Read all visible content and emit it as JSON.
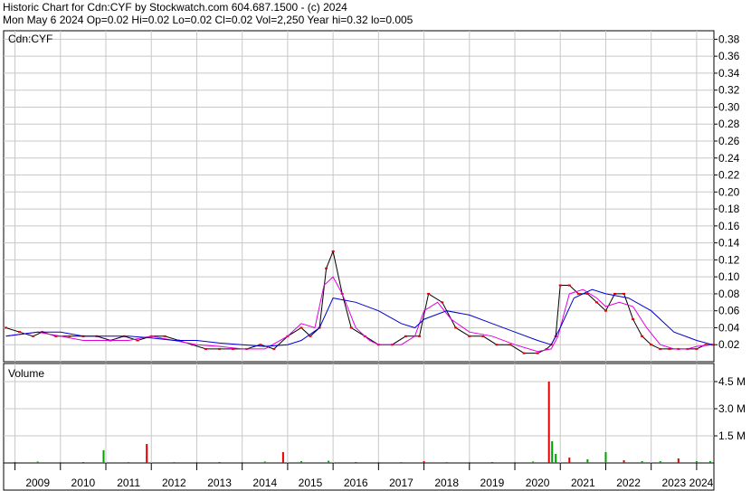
{
  "header": {
    "line1": "Historic Chart for Cdn:CYF by Stockwatch.com 604.687.1500 - (c) 2024",
    "line2": "Mon May  6 2024  Op=0.02  Hi=0.02  Lo=0.02  Cl=0.02  Vol=2,250  Year hi=0.32  lo=0.005"
  },
  "colors": {
    "price_bar": "#000000",
    "down_close": "#e00000",
    "ma_short": "#e000e0",
    "ma_long": "#0000d0",
    "volume_up": "#00a000",
    "volume_down": "#e00000",
    "grid": "#c8c8c8"
  },
  "chart_data": [
    {
      "type": "line",
      "title": "Cdn:CYF",
      "ylim": [
        0,
        0.39
      ],
      "yticks": [
        "0.02",
        "0.04",
        "0.06",
        "0.08",
        "0.10",
        "0.12",
        "0.14",
        "0.16",
        "0.18",
        "0.20",
        "0.22",
        "0.24",
        "0.26",
        "0.28",
        "0.30",
        "0.32",
        "0.34",
        "0.36",
        "0.38"
      ],
      "x_labels": [
        "2009",
        "2010",
        "2011",
        "2012",
        "2013",
        "2014",
        "2015",
        "2016",
        "2017",
        "2018",
        "2019",
        "2020",
        "2021",
        "2022",
        "2023",
        "2024"
      ],
      "series": [
        {
          "key": "price",
          "x": [
            2008.8,
            2009.1,
            2009.4,
            2009.6,
            2009.9,
            2010.2,
            2010.5,
            2010.8,
            2011.1,
            2011.4,
            2011.7,
            2012.0,
            2012.3,
            2012.6,
            2012.9,
            2013.2,
            2013.5,
            2013.8,
            2014.1,
            2014.4,
            2014.7,
            2015.0,
            2015.3,
            2015.5,
            2015.7,
            2015.85,
            2016.0,
            2016.2,
            2016.4,
            2016.7,
            2017.0,
            2017.3,
            2017.6,
            2017.9,
            2018.1,
            2018.4,
            2018.7,
            2019.0,
            2019.3,
            2019.6,
            2019.9,
            2020.2,
            2020.5,
            2020.7,
            2020.8,
            2020.9,
            2021.0,
            2021.2,
            2021.4,
            2021.6,
            2021.8,
            2022.0,
            2022.2,
            2022.4,
            2022.6,
            2022.8,
            2023.0,
            2023.2,
            2023.4,
            2023.6,
            2023.8,
            2024.0,
            2024.2,
            2024.35
          ],
          "values": [
            0.04,
            0.035,
            0.03,
            0.035,
            0.03,
            0.03,
            0.03,
            0.03,
            0.025,
            0.03,
            0.025,
            0.03,
            0.03,
            0.025,
            0.02,
            0.015,
            0.015,
            0.015,
            0.015,
            0.02,
            0.015,
            0.03,
            0.04,
            0.03,
            0.04,
            0.11,
            0.13,
            0.08,
            0.04,
            0.03,
            0.02,
            0.02,
            0.03,
            0.03,
            0.08,
            0.07,
            0.04,
            0.03,
            0.03,
            0.02,
            0.02,
            0.01,
            0.01,
            0.015,
            0.02,
            0.03,
            0.09,
            0.09,
            0.08,
            0.08,
            0.07,
            0.06,
            0.08,
            0.08,
            0.05,
            0.03,
            0.02,
            0.015,
            0.015,
            0.015,
            0.015,
            0.015,
            0.02,
            0.02
          ]
        },
        {
          "key": "ma_short",
          "x": [
            2008.8,
            2009.5,
            2010.0,
            2010.5,
            2011.0,
            2011.5,
            2012.0,
            2012.5,
            2013.0,
            2013.5,
            2014.0,
            2014.5,
            2015.0,
            2015.3,
            2015.6,
            2015.8,
            2016.0,
            2016.2,
            2016.5,
            2016.8,
            2017.0,
            2017.5,
            2017.8,
            2018.0,
            2018.3,
            2018.6,
            2019.0,
            2019.5,
            2020.0,
            2020.5,
            2020.8,
            2020.95,
            2021.2,
            2021.5,
            2021.8,
            2022.0,
            2022.3,
            2022.6,
            2022.9,
            2023.2,
            2023.5,
            2023.8,
            2024.0,
            2024.35
          ],
          "values": [
            0.03,
            0.035,
            0.03,
            0.025,
            0.025,
            0.025,
            0.03,
            0.025,
            0.02,
            0.018,
            0.015,
            0.015,
            0.03,
            0.045,
            0.04,
            0.09,
            0.1,
            0.08,
            0.04,
            0.025,
            0.02,
            0.02,
            0.03,
            0.06,
            0.07,
            0.05,
            0.035,
            0.03,
            0.02,
            0.012,
            0.015,
            0.03,
            0.08,
            0.085,
            0.075,
            0.065,
            0.07,
            0.065,
            0.04,
            0.02,
            0.015,
            0.015,
            0.018,
            0.02
          ]
        },
        {
          "key": "ma_long",
          "x": [
            2008.8,
            2009.5,
            2010.0,
            2010.5,
            2011.0,
            2011.5,
            2012.0,
            2012.5,
            2013.0,
            2013.5,
            2014.0,
            2014.5,
            2015.0,
            2015.3,
            2015.7,
            2016.0,
            2016.5,
            2017.0,
            2017.5,
            2017.8,
            2018.0,
            2018.5,
            2019.0,
            2019.5,
            2020.0,
            2020.5,
            2020.8,
            2021.0,
            2021.3,
            2021.7,
            2022.0,
            2022.5,
            2023.0,
            2023.5,
            2024.0,
            2024.35
          ],
          "values": [
            0.03,
            0.035,
            0.035,
            0.03,
            0.03,
            0.03,
            0.028,
            0.025,
            0.025,
            0.022,
            0.02,
            0.018,
            0.02,
            0.025,
            0.04,
            0.075,
            0.07,
            0.06,
            0.045,
            0.04,
            0.05,
            0.06,
            0.055,
            0.045,
            0.035,
            0.025,
            0.02,
            0.04,
            0.075,
            0.085,
            0.08,
            0.075,
            0.06,
            0.035,
            0.025,
            0.02
          ]
        }
      ]
    },
    {
      "type": "bar",
      "title": "Volume",
      "ylim": [
        0,
        5.5
      ],
      "yticks": [
        "1.5 M",
        "3.0 M",
        "4.5 M"
      ],
      "x": [
        2009.0,
        2009.5,
        2010.0,
        2010.5,
        2010.95,
        2011.5,
        2011.9,
        2012.5,
        2013.0,
        2013.5,
        2014.0,
        2014.5,
        2014.9,
        2015.3,
        2015.9,
        2016.5,
        2017.0,
        2017.5,
        2018.0,
        2018.5,
        2019.0,
        2019.5,
        2020.0,
        2020.4,
        2020.75,
        2020.82,
        2020.9,
        2021.2,
        2021.6,
        2022.0,
        2022.4,
        2022.8,
        2023.2,
        2023.6,
        2024.0,
        2024.3
      ],
      "values": [
        0.05,
        0.08,
        0.05,
        0.05,
        0.7,
        0.05,
        1.05,
        0.05,
        0.05,
        0.05,
        0.05,
        0.08,
        0.6,
        0.1,
        0.12,
        0.05,
        0.05,
        0.05,
        0.1,
        0.05,
        0.05,
        0.05,
        0.05,
        0.08,
        4.5,
        1.2,
        0.5,
        0.3,
        0.2,
        0.6,
        0.15,
        0.1,
        0.1,
        0.25,
        0.1,
        0.1
      ]
    }
  ]
}
